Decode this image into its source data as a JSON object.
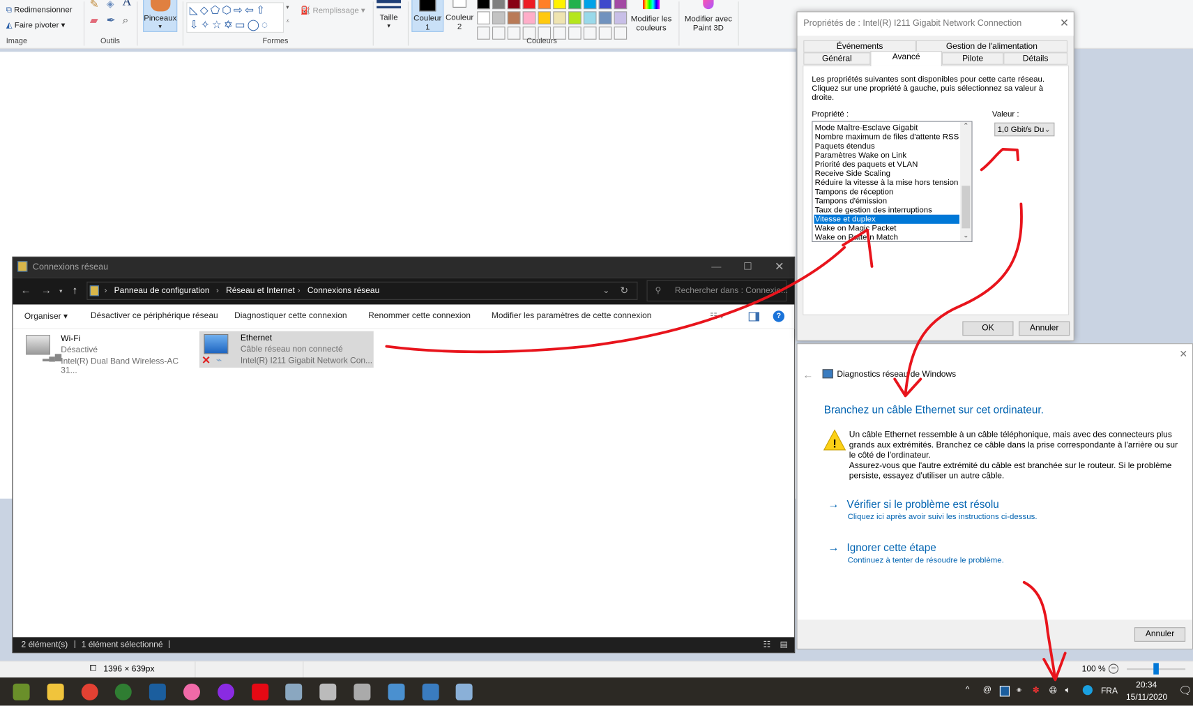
{
  "paint": {
    "image_group": {
      "resize": "Redimensionner",
      "rotate": "Faire pivoter",
      "label": "Image"
    },
    "tools_label": "Outils",
    "brushes": "Pinceaux",
    "shapes_label": "Formes",
    "fill": "Remplissage",
    "size": "Taille",
    "color1": "Couleur 1",
    "color2": "Couleur 2",
    "colors_label": "Couleurs",
    "edit_colors": "Modifier les couleurs",
    "edit_paint3d": "Modifier avec Paint 3D",
    "palette_row1": [
      "#000000",
      "#7f7f7f",
      "#880015",
      "#ed1c24",
      "#ff7f27",
      "#fff200",
      "#22b14c",
      "#00a2e8",
      "#3f48cc",
      "#a349a4"
    ],
    "palette_row2": [
      "#ffffff",
      "#c3c3c3",
      "#b97a57",
      "#ffaec9",
      "#ffc90e",
      "#efe4b0",
      "#b5e61d",
      "#99d9ea",
      "#7092be",
      "#c8bfe7"
    ],
    "status": {
      "dimensions": "1396 × 639px",
      "zoom": "100 %",
      "zoom_level": 0.5
    }
  },
  "explorer": {
    "title": "Connexions réseau",
    "breadcrumb": [
      "Panneau de configuration",
      "Réseau et Internet",
      "Connexions réseau"
    ],
    "search_placeholder": "Rechercher dans : Connexio...",
    "commands": {
      "organize": "Organiser ▾",
      "disable": "Désactiver ce périphérique réseau",
      "diagnose": "Diagnostiquer cette connexion",
      "rename": "Renommer cette connexion",
      "change": "Modifier les paramètres de cette connexion"
    },
    "items": [
      {
        "name": "Wi-Fi",
        "status": "Désactivé",
        "adapter": "Intel(R) Dual Band Wireless-AC 31..."
      },
      {
        "name": "Ethernet",
        "status": "Câble réseau non connecté",
        "adapter": "Intel(R) I211 Gigabit Network Con..."
      }
    ],
    "status": {
      "count": "2 élément(s)",
      "selected": "1 élément sélectionné"
    }
  },
  "properties": {
    "title": "Propriétés de : Intel(R) I211 Gigabit Network Connection",
    "tabs_row1": [
      "Événements",
      "Gestion de l'alimentation"
    ],
    "tabs_row2": [
      "Général",
      "Avancé",
      "Pilote",
      "Détails"
    ],
    "active_tab": "Avancé",
    "description": "Les propriétés suivantes sont disponibles pour cette carte réseau. Cliquez sur une propriété à gauche, puis sélectionnez sa valeur à droite.",
    "property_label": "Propriété :",
    "value_label": "Valeur :",
    "properties": [
      "Mode Maître-Esclave Gigabit",
      "Nombre maximum de files d'attente RSS",
      "Paquets étendus",
      "Paramètres Wake on Link",
      "Priorité des paquets et VLAN",
      "Receive Side Scaling",
      "Réduire la vitesse à la mise hors tension",
      "Tampons de réception",
      "Tampons d'émission",
      "Taux de gestion des interruptions",
      "Vitesse et duplex",
      "Wake on Magic Packet",
      "Wake on Pattern Match"
    ],
    "selected_property": "Vitesse et duplex",
    "value": "1,0 Gbit/s Du",
    "ok": "OK",
    "cancel": "Annuler"
  },
  "diagnostics": {
    "title": "Diagnostics réseau de Windows",
    "heading": "Branchez un câble Ethernet sur cet ordinateur.",
    "body1": "Un câble Ethernet ressemble à un câble téléphonique, mais avec des connecteurs plus grands aux extrémités. Branchez ce câble dans la prise correspondante à l'arrière ou sur le côté de l'ordinateur.",
    "body2": "Assurez-vous que l'autre extrémité du câble est branchée sur le routeur. Si le problème persiste, essayez d'utiliser un autre câble.",
    "option1": {
      "title": "Vérifier si le problème est résolu",
      "sub": "Cliquez ici après avoir suivi les instructions ci-dessus."
    },
    "option2": {
      "title": "Ignorer cette étape",
      "sub": "Continuez à tenter de résoudre le problème."
    },
    "cancel": "Annuler"
  },
  "taskbar": {
    "apps": [
      "cuphead",
      "file-explorer",
      "chrome",
      "xbox",
      "lightshot",
      "osu",
      "cortana-ring",
      "netflix",
      "network",
      "obs",
      "disc",
      "control-panel",
      "network-connections",
      "paint"
    ],
    "app_colors": [
      "#6a8f2a",
      "#f0c43c",
      "#e34133",
      "#2f7d32",
      "#1b5e9e",
      "#f06aa8",
      "#8a2be2",
      "#e50914",
      "#8aa7c0",
      "#bbb",
      "#aaa",
      "#4a90d0",
      "#3a7cc0",
      "#8ab0d8"
    ],
    "language": "FRA",
    "time": "20:34",
    "date": "15/11/2020"
  },
  "annotation_color": "#e8141c"
}
